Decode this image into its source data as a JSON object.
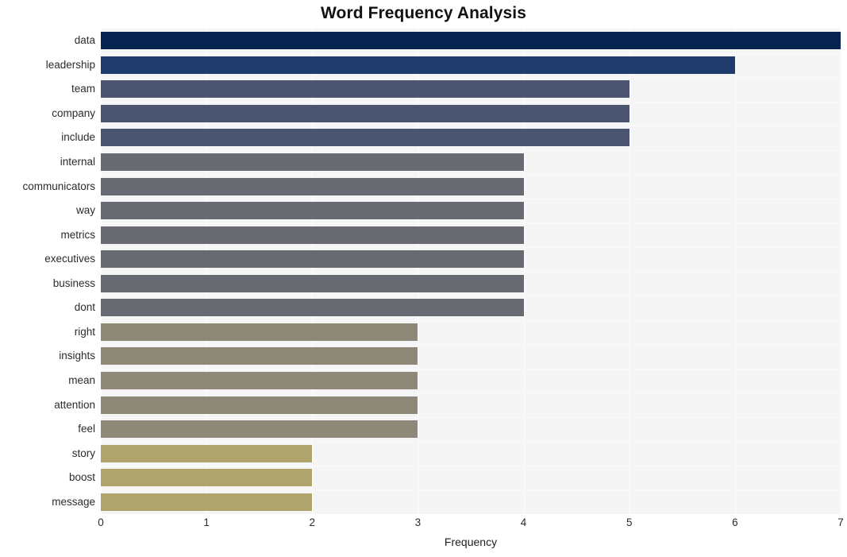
{
  "chart_data": {
    "type": "bar",
    "orientation": "horizontal",
    "title": "Word Frequency Analysis",
    "xlabel": "Frequency",
    "ylabel": "",
    "categories": [
      "data",
      "leadership",
      "team",
      "company",
      "include",
      "internal",
      "communicators",
      "way",
      "metrics",
      "executives",
      "business",
      "dont",
      "right",
      "insights",
      "mean",
      "attention",
      "feel",
      "story",
      "boost",
      "message"
    ],
    "values": [
      7,
      6,
      5,
      5,
      5,
      4,
      4,
      4,
      4,
      4,
      4,
      4,
      3,
      3,
      3,
      3,
      3,
      2,
      2,
      2
    ],
    "bar_colors": [
      "#06244f",
      "#1f3b6e",
      "#4b5570",
      "#4b5570",
      "#4b5570",
      "#676a70",
      "#676a70",
      "#676a70",
      "#676a70",
      "#676a70",
      "#676a70",
      "#676a70",
      "#8d8878",
      "#8d8878",
      "#8d8878",
      "#8d8878",
      "#8d8878",
      "#b0a46d",
      "#b0a46d",
      "#b0a46d"
    ],
    "xlim": [
      0,
      7
    ],
    "xticks": [
      0,
      1,
      2,
      3,
      4,
      5,
      6,
      7
    ],
    "xtick_labels": [
      "0",
      "1",
      "2",
      "3",
      "4",
      "5",
      "6",
      "7"
    ],
    "grid": true,
    "grid_color": "#ffffff",
    "plot_background": "#f5f5f6",
    "figure_background": "#ffffff",
    "legend": null
  }
}
